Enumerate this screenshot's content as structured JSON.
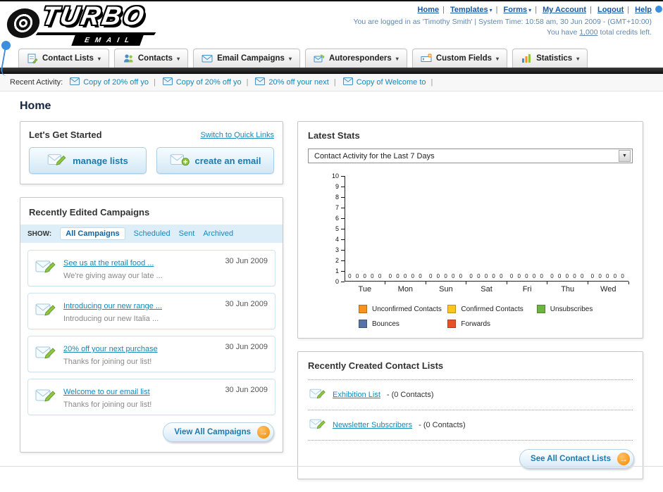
{
  "header": {
    "logo": {
      "word": "TURBO",
      "sub": "EMAIL"
    },
    "links": [
      {
        "label": "Home",
        "dropdown": false
      },
      {
        "label": "Templates",
        "dropdown": true
      },
      {
        "label": "Forms",
        "dropdown": true
      },
      {
        "label": "My Account",
        "dropdown": false
      },
      {
        "label": "Logout",
        "dropdown": false
      },
      {
        "label": "Help",
        "dropdown": false
      }
    ],
    "login_info": "You are logged in as 'Timothy Smith' | System Time: 10:58 am, 30 Jun 2009 - (GMT+10:00)",
    "credits_prefix": "You have",
    "credits_value": "1,000",
    "credits_suffix": "total credits left."
  },
  "nav_tabs": [
    {
      "label": "Contact Lists"
    },
    {
      "label": "Contacts"
    },
    {
      "label": "Email Campaigns"
    },
    {
      "label": "Autoresponders"
    },
    {
      "label": "Custom Fields"
    },
    {
      "label": "Statistics"
    }
  ],
  "recent_activity": {
    "label": "Recent Activity:",
    "items": [
      {
        "text": "Copy of 20% off yo"
      },
      {
        "text": "Copy of 20% off yo"
      },
      {
        "text": "20% off your next"
      },
      {
        "text": "Copy of Welcome to"
      }
    ]
  },
  "page_title": "Home",
  "get_started": {
    "title": "Let's Get Started",
    "switch_link": "Switch to Quick Links",
    "manage_lists_label": "manage lists",
    "create_email_label": "create an email"
  },
  "campaigns": {
    "title": "Recently Edited Campaigns",
    "show_label": "SHOW:",
    "filters": [
      {
        "label": "All Campaigns",
        "active": true
      },
      {
        "label": "Scheduled",
        "active": false
      },
      {
        "label": "Sent",
        "active": false
      },
      {
        "label": "Archived",
        "active": false
      }
    ],
    "items": [
      {
        "title": "See us at the retail food ...",
        "subtitle": "We're giving away our late ...",
        "date": "30 Jun 2009"
      },
      {
        "title": "Introducing our new range ...",
        "subtitle": "Introducing our new Italia ...",
        "date": "30 Jun 2009"
      },
      {
        "title": "20% off your next purchase",
        "subtitle": "Thanks for joining our list!",
        "date": "30 Jun 2009"
      },
      {
        "title": "Welcome to our email list",
        "subtitle": "Thanks for joining our list!",
        "date": "30 Jun 2009"
      }
    ],
    "view_all_label": "View All Campaigns"
  },
  "stats": {
    "title": "Latest Stats",
    "dropdown_value": "Contact Activity for the Last 7 Days"
  },
  "chart_data": {
    "type": "bar",
    "title": "Contact Activity for the Last 7 Days",
    "categories": [
      "Tue",
      "Mon",
      "Sun",
      "Sat",
      "Fri",
      "Thu",
      "Wed"
    ],
    "series": [
      {
        "name": "Unconfirmed Contacts",
        "color": "#f6921e",
        "values": [
          0,
          0,
          0,
          0,
          0,
          0,
          0
        ]
      },
      {
        "name": "Confirmed Contacts",
        "color": "#fdc51e",
        "values": [
          0,
          0,
          0,
          0,
          0,
          0,
          0
        ]
      },
      {
        "name": "Unsubscribes",
        "color": "#6cb33f",
        "values": [
          0,
          0,
          0,
          0,
          0,
          0,
          0
        ]
      },
      {
        "name": "Bounces",
        "color": "#5573a6",
        "values": [
          0,
          0,
          0,
          0,
          0,
          0,
          0
        ]
      },
      {
        "name": "Forwards",
        "color": "#e8502a",
        "values": [
          0,
          0,
          0,
          0,
          0,
          0,
          0
        ]
      }
    ],
    "xlabel": "",
    "ylabel": "",
    "ylim": [
      0,
      10
    ],
    "yticks": [
      0,
      1,
      2,
      3,
      4,
      5,
      6,
      7,
      8,
      9,
      10
    ],
    "grid": false,
    "legend_position": "bottom"
  },
  "contact_lists": {
    "title": "Recently Created Contact Lists",
    "items": [
      {
        "name": "Exhibition List",
        "detail": "- (0 Contacts)"
      },
      {
        "name": "Newsletter Subscribers",
        "detail": "- (0 Contacts)"
      }
    ],
    "see_all_label": "See All Contact Lists"
  }
}
